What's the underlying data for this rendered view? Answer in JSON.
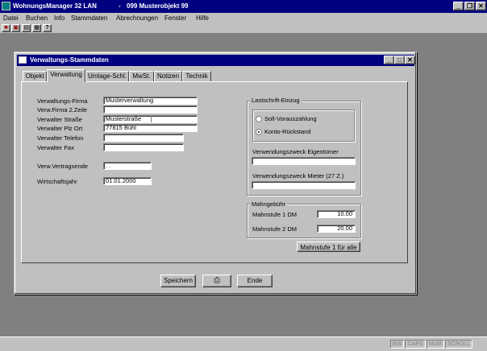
{
  "app": {
    "title": "WohnungsManager 32 LAN",
    "subtitle": "099 Musterobjekt 99",
    "controls": [
      "_",
      "µ",
      "×"
    ]
  },
  "menu": [
    "Datei",
    "Buchen",
    "Info",
    "Stammdaten",
    "Abrechnungen",
    "Fenster",
    "Hilfe"
  ],
  "dialog": {
    "title": "Verwaltungs-Stammdaten",
    "tabs": [
      "Objekt",
      "Verwaltung",
      "Umlage-Schl.",
      "MwSt.",
      "Notizen",
      "Technik"
    ],
    "active_tab": "Verwaltung",
    "fields": {
      "firma": {
        "label": "Verwaltungs-Firma",
        "value": "Musterverwaltung"
      },
      "firma2": {
        "label": "Verw.Firma 2.Zeile",
        "value": ""
      },
      "strasse": {
        "label": "Verwalter Straße",
        "value": "Musterstraße"
      },
      "plz_ort": {
        "label": "Verwalter Plz Ort",
        "value": "77815 Bühl"
      },
      "telefon": {
        "label": "Verwalter Telefon",
        "value": ""
      },
      "fax": {
        "label": "Verwalter Fax",
        "value": ""
      },
      "vertragsende": {
        "label": "Verw.Vertragsende",
        "value": " .  ."
      },
      "wirtschaftsjahr": {
        "label": "Wirtschaftsjahr",
        "value": "01.01.2000"
      }
    },
    "lastschrift": {
      "title": "Lastschrift-Einzug",
      "options": [
        "Soll-Vorauszahlung",
        "Konto-Rückstand"
      ],
      "selected": 1,
      "zweck_eigentuemer": {
        "label": "Verwendungszweck Eigentümer",
        "value": ""
      },
      "zweck_mieter": {
        "label": "Verwendungszweck Mieter (27 Z.)",
        "value": ""
      }
    },
    "mahngebuehr": {
      "title": "Mahngebühr",
      "stufe1": {
        "label": "Mahnstufe 1 DM",
        "value": "10.00"
      },
      "stufe2": {
        "label": "Mahnstufe 2 DM",
        "value": "20.00"
      },
      "button": "Mahnstufe 1 für alle"
    },
    "buttons": {
      "save": "Speichern",
      "print": "⎙",
      "end": "Ende"
    }
  },
  "status": [
    "INS",
    "CAPS",
    "NUM",
    "SCROLL"
  ]
}
